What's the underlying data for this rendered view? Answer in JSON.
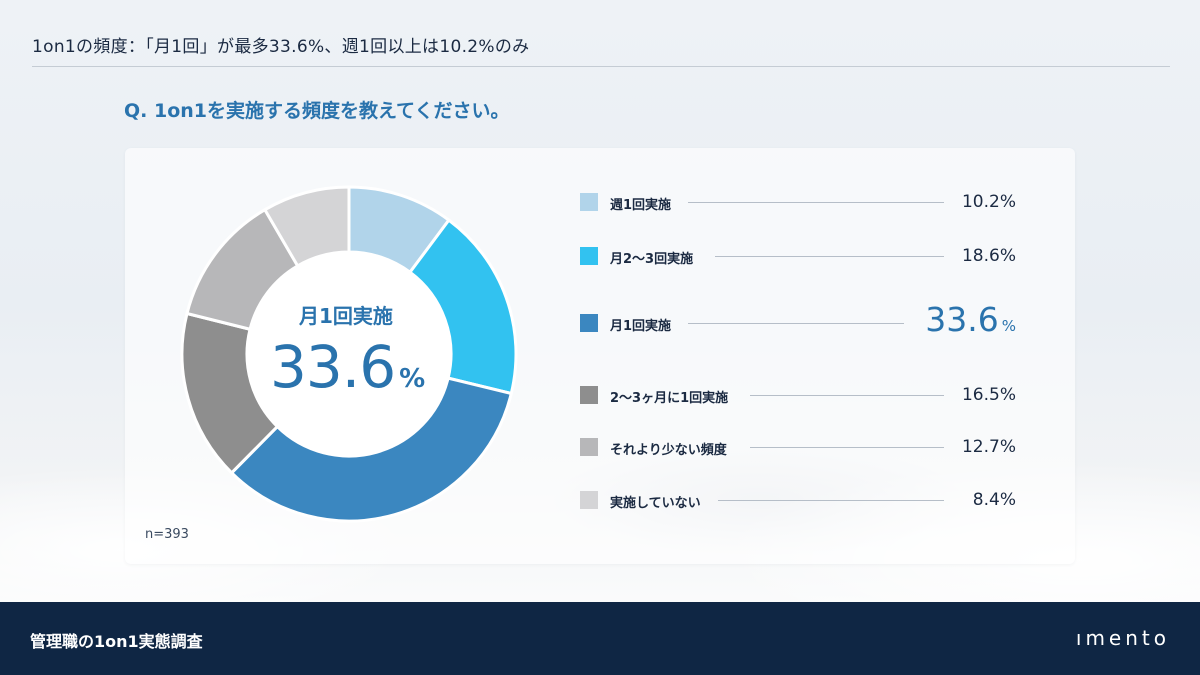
{
  "header": {
    "title": "1on1の頻度：「月1回」が最多33.6%、週1回以上は10.2%のみ"
  },
  "question": "Q. 1on1を実施する頻度を教えてください。",
  "center": {
    "label": "月1回実施",
    "value": "33.6",
    "unit": "%"
  },
  "sample_size": "n=393",
  "chart_data": {
    "type": "pie",
    "variant": "donut",
    "categories": [
      "週1回実施",
      "月2〜3回実施",
      "月1回実施",
      "2〜3ヶ月に1回実施",
      "それより少ない頻度",
      "実施していない"
    ],
    "values": [
      10.2,
      18.6,
      33.6,
      16.5,
      12.7,
      8.4
    ],
    "value_labels": [
      "10.2%",
      "18.6%",
      "33.6",
      "16.5%",
      "12.7%",
      "8.4%"
    ],
    "unit": "%",
    "colors": [
      "#b1d4ea",
      "#32c2f0",
      "#3b87c0",
      "#8e8e8e",
      "#b7b7b9",
      "#d4d4d6"
    ],
    "highlight_index": 2,
    "highlight_unit": "%",
    "legend_position": "right"
  },
  "footer": {
    "title": "管理職の1on1実態調査",
    "logo": "ımento"
  }
}
